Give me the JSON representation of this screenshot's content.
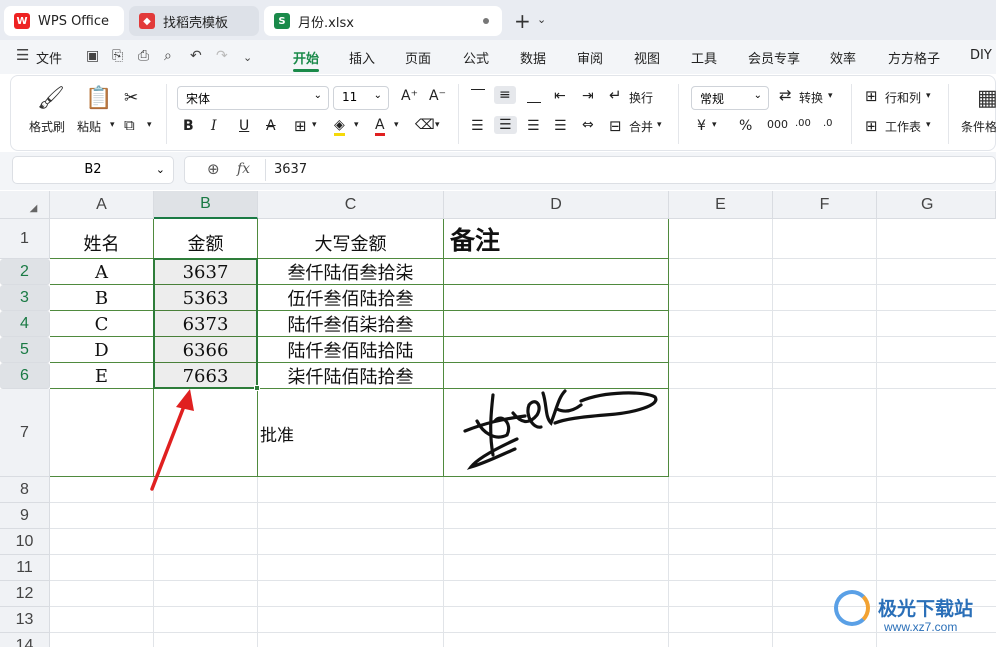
{
  "tabs": [
    {
      "label": "WPS Office",
      "icon": "wps-logo"
    },
    {
      "label": "找稻壳模板",
      "icon": "docer-logo"
    },
    {
      "label": "月份.xlsx",
      "icon": "spreadsheet-logo",
      "icon_text": "S"
    }
  ],
  "menu": [
    "文件",
    "开始",
    "插入",
    "页面",
    "公式",
    "数据",
    "审阅",
    "视图",
    "工具",
    "会员专享",
    "效率",
    "方方格子",
    "DIY"
  ],
  "active_menu": "开始",
  "ribbon": {
    "format_painter": "格式刷",
    "paste": "粘贴",
    "font_name": "宋体",
    "font_size": "11",
    "wrap": "换行",
    "merge": "合并",
    "number_format": "常规",
    "convert": "转换",
    "row_col": "行和列",
    "worksheet": "工作表",
    "cond_format": "条件格"
  },
  "formula_bar": {
    "cell_ref": "B2",
    "fx": "fx",
    "value": "3637"
  },
  "columns": [
    "A",
    "B",
    "C",
    "D",
    "E",
    "F",
    "G"
  ],
  "rows": [
    "1",
    "2",
    "3",
    "4",
    "5",
    "6",
    "7",
    "8",
    "9",
    "10",
    "11",
    "12",
    "13",
    "14"
  ],
  "table": {
    "headers": [
      "姓名",
      "金额",
      "大写金额",
      "备注"
    ],
    "rows": [
      [
        "A",
        "3637",
        "叁仟陆佰叁拾柒",
        ""
      ],
      [
        "B",
        "5363",
        "伍仟叁佰陆拾叁",
        ""
      ],
      [
        "C",
        "6373",
        "陆仟叁佰柒拾叁",
        ""
      ],
      [
        "D",
        "6366",
        "陆仟叁佰陆拾陆",
        ""
      ],
      [
        "E",
        "7663",
        "柒仟陆佰陆拾叁",
        ""
      ]
    ],
    "approval_label": "批准"
  },
  "watermark": {
    "name": "极光下载站",
    "url": "www.xz7.com"
  },
  "colors": {
    "accent": "#1a8a4a",
    "border": "#4f8a3e",
    "arrow": "#e02020"
  }
}
